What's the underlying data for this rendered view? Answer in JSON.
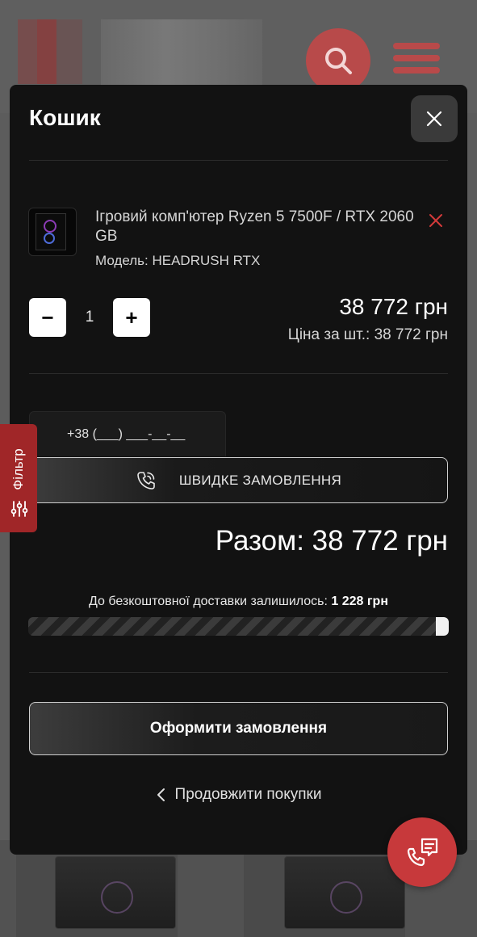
{
  "cart": {
    "title": "Кошик",
    "item": {
      "name": "Ігровий комп'ютер Ryzen 5 7500F / RTX 2060 GB",
      "model": "Модель: HEADRUSH RTX",
      "quantity": "1",
      "minus_label": "−",
      "plus_label": "+",
      "price": "38 772 грн",
      "unit_price": "Ціна за шт.: 38 772 грн"
    },
    "quick_order": {
      "phone_placeholder": "+38 (___) ___-__-__",
      "button_label": "ШВИДКЕ ЗАМОВЛЕННЯ"
    },
    "total": "Разом: 38 772 грн",
    "delivery": {
      "text": "До безкоштовної доставки залишилось:",
      "amount": "1 228 грн",
      "progress_fraction": 0.03
    },
    "checkout_label": "Оформити замовлення",
    "continue_label": "Продовжити покупки"
  },
  "filter_tab": {
    "label": "Фільтр"
  },
  "icons": {
    "close": "close-icon",
    "remove": "remove-item-icon",
    "phone": "phone-icon",
    "chevron": "chevron-left-icon",
    "filter": "filter-sliders-icon",
    "chat": "chat-icon",
    "search": "search-icon",
    "menu": "menu-icon"
  },
  "colors": {
    "accent_red": "#c7393b",
    "modal_bg": "#121212",
    "remove_red": "#d23a3a"
  }
}
